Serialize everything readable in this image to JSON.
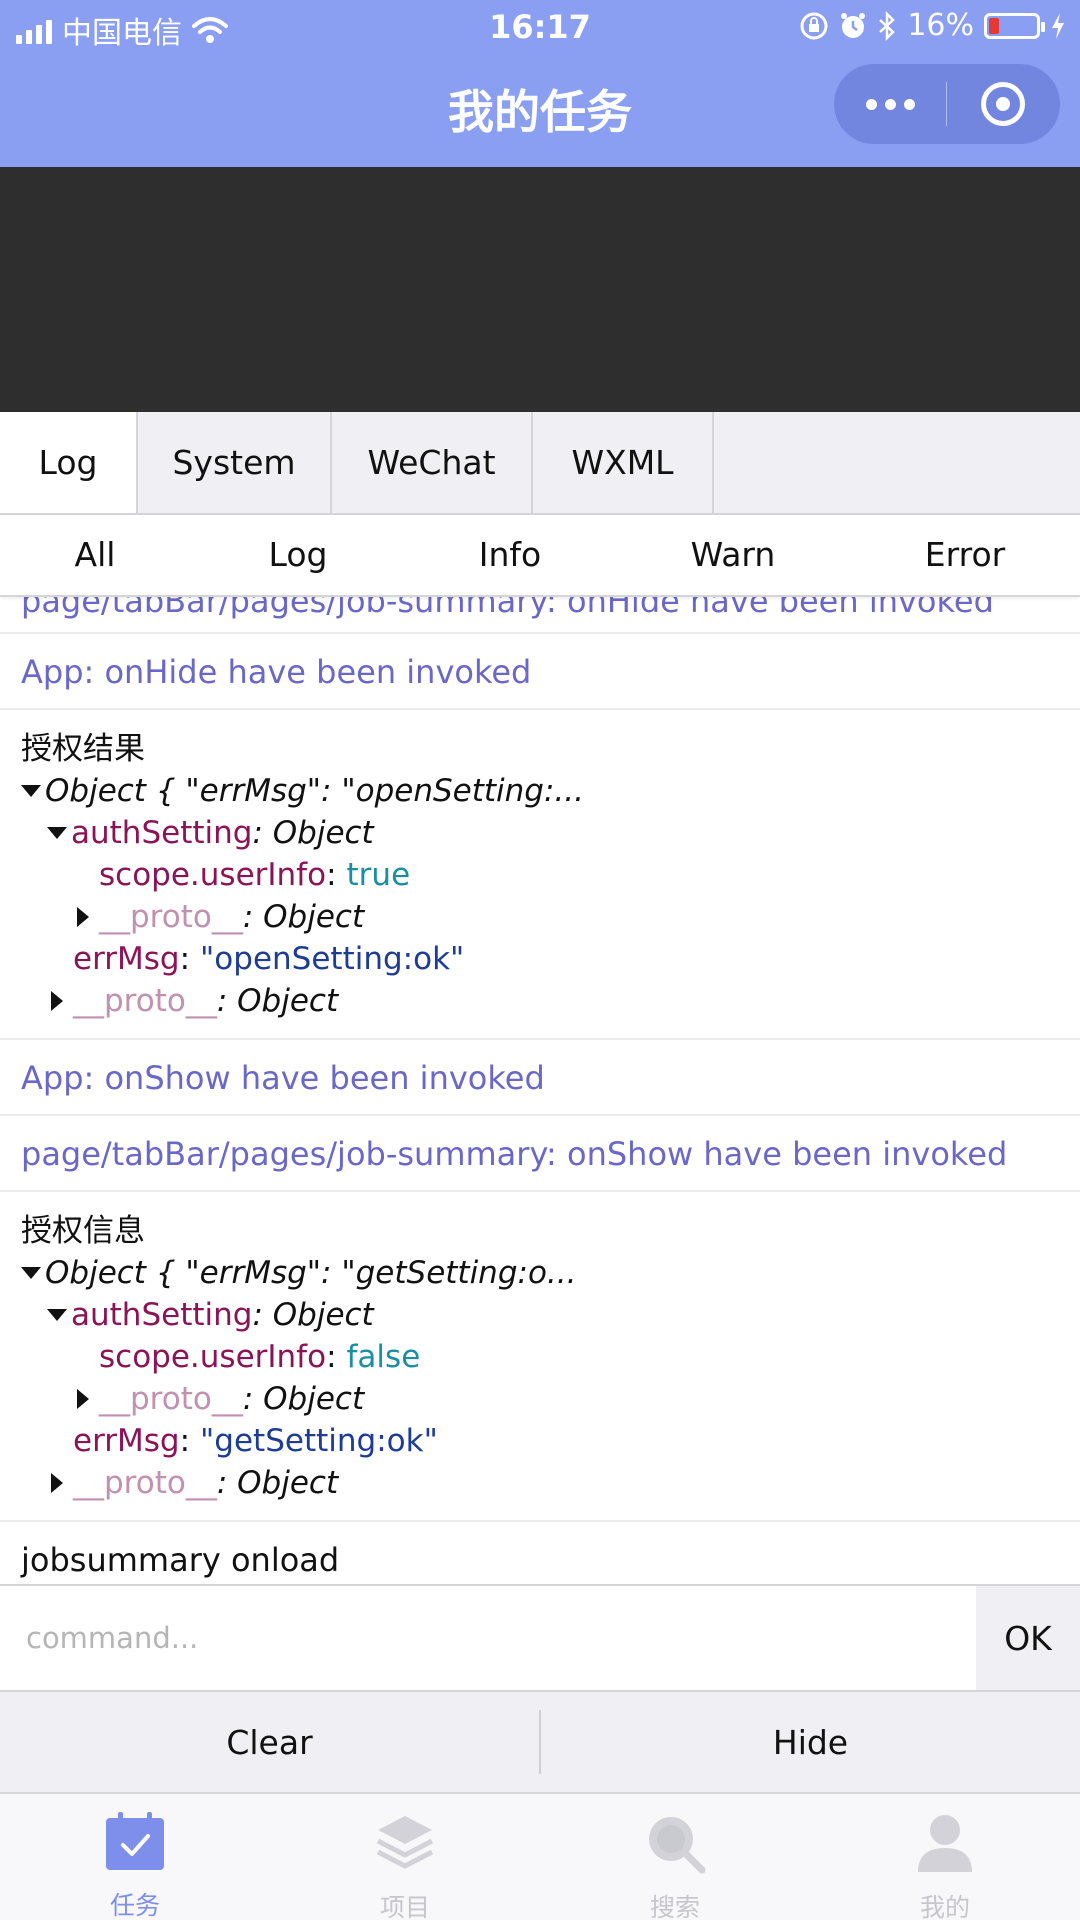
{
  "status_bar": {
    "carrier": "中国电信",
    "time": "16:17",
    "battery_percent": "16%",
    "battery_level": 0.16
  },
  "nav": {
    "title": "我的任务"
  },
  "colors": {
    "nav_bg": "#8a9ff2",
    "capsule_bg": "#7286df",
    "log_purple": "#6b67c8",
    "key_color": "#8b1456",
    "bool_color": "#1a8ea5",
    "string_color": "#1d3c96",
    "active_tab_color": "#7d8fea"
  },
  "console": {
    "tabs": [
      "Log",
      "System",
      "WeChat",
      "WXML"
    ],
    "active_tab": "Log",
    "filters": [
      "All",
      "Log",
      "Info",
      "Warn",
      "Error"
    ],
    "logs": {
      "cut_line": "page/tabBar/pages/job-summary: onHide have been invoked",
      "app_onhide": "App: onHide have been invoked",
      "block1": {
        "title": "授权结果",
        "summary": "Object { \"errMsg\": \"openSetting:...",
        "auth_key": "authSetting",
        "auth_type": ": Object",
        "scope_key": "scope.userInfo",
        "colon": ":",
        "scope_value": "true",
        "proto_key": "__proto__",
        "proto_type": ": Object",
        "errmsg_key": "errMsg",
        "errmsg_value": "\"openSetting:ok\"",
        "outer_proto_key": "__proto__",
        "outer_proto_type": ": Object"
      },
      "app_onshow": "App: onShow have been invoked",
      "page_onshow": "page/tabBar/pages/job-summary: onShow have been invoked",
      "block2": {
        "title": "授权信息",
        "summary": "Object { \"errMsg\": \"getSetting:o...",
        "auth_key": "authSetting",
        "auth_type": ": Object",
        "scope_key": "scope.userInfo",
        "colon": ":",
        "scope_value": "false",
        "proto_key": "__proto__",
        "proto_type": ": Object",
        "errmsg_key": "errMsg",
        "errmsg_value": "\"getSetting:ok\"",
        "outer_proto_key": "__proto__",
        "outer_proto_type": ": Object"
      },
      "jobsummary": "jobsummary onload"
    },
    "command": {
      "placeholder": "command...",
      "ok_label": "OK"
    },
    "actions": {
      "clear": "Clear",
      "hide": "Hide"
    }
  },
  "tabbar": {
    "items": [
      {
        "label": "任务",
        "icon": "task-check-icon",
        "active": true
      },
      {
        "label": "项目",
        "icon": "layers-icon",
        "active": false
      },
      {
        "label": "搜索",
        "icon": "search-icon",
        "active": false
      },
      {
        "label": "我的",
        "icon": "user-icon",
        "active": false
      }
    ]
  }
}
